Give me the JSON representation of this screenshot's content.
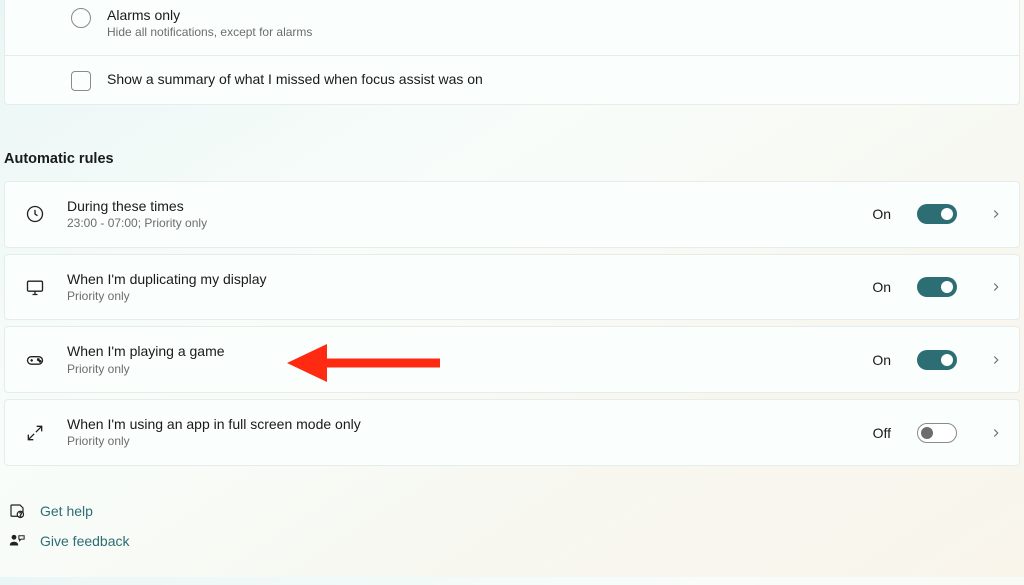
{
  "options": {
    "alarms_only": {
      "title": "Alarms only",
      "desc": "Hide all notifications, except for alarms"
    },
    "summary": {
      "title": "Show a summary of what I missed when focus assist was on"
    }
  },
  "section_heading": "Automatic rules",
  "state": {
    "on": "On",
    "off": "Off"
  },
  "rules": [
    {
      "icon": "clock",
      "title": "During these times",
      "desc": "23:00 - 07:00; Priority only",
      "on": true
    },
    {
      "icon": "monitor",
      "title": "When I'm duplicating my display",
      "desc": "Priority only",
      "on": true
    },
    {
      "icon": "gamepad",
      "title": "When I'm playing a game",
      "desc": "Priority only",
      "on": true
    },
    {
      "icon": "fullscreen",
      "title": "When I'm using an app in full screen mode only",
      "desc": "Priority only",
      "on": false
    }
  ],
  "footer": {
    "help": "Get help",
    "feedback": "Give feedback"
  }
}
